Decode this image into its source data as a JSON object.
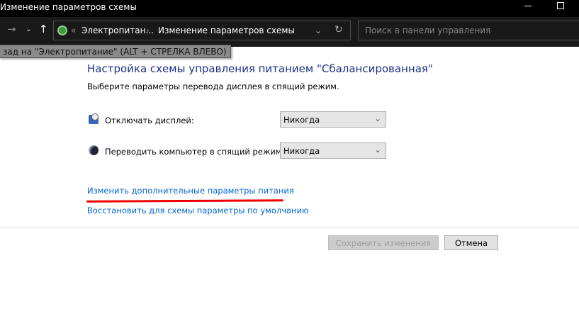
{
  "window": {
    "title": "Изменение параметров схемы"
  },
  "toolbar": {
    "breadcrumb": [
      "Электропитан...",
      "Изменение параметров схемы"
    ],
    "search_placeholder": "Поиск в панели управления",
    "tooltip": "зад на \"Электропитание\" (ALT + СТРЕЛКА ВЛЕВО)"
  },
  "main": {
    "heading": "Настройка схемы управления питанием \"Сбалансированная\"",
    "subtitle": "Выберите параметры перевода дисплея в спящий режим.",
    "display_off": {
      "label": "Отключать дисплей:",
      "value": "Никогда"
    },
    "sleep": {
      "label": "Переводить компьютер в спящий режим:",
      "value": "Никогда"
    },
    "advanced_link": "Изменить дополнительные параметры питания",
    "restore_link": "Восстановить для схемы параметры по умолчанию",
    "save_button": "Сохранить изменения",
    "cancel_button": "Отмена"
  }
}
